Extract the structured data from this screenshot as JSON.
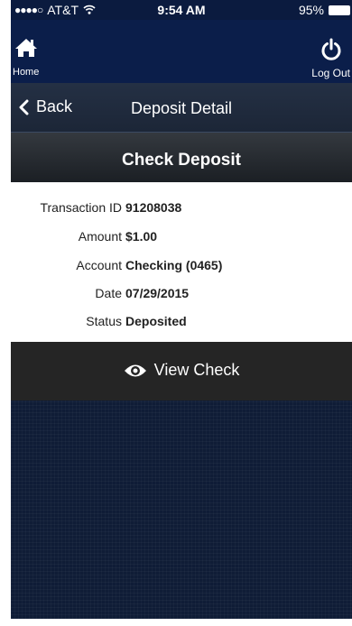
{
  "status_bar": {
    "signal_dots": "●●●●○",
    "carrier": "AT&T",
    "time": "9:54 AM",
    "battery_percent": "95%"
  },
  "header": {
    "home_label": "Home",
    "logout_label": "Log Out"
  },
  "nav": {
    "back_label": "Back",
    "title": "Deposit Detail"
  },
  "section": {
    "title": "Check Deposit"
  },
  "details": [
    {
      "label": "Transaction ID",
      "value": "91208038"
    },
    {
      "label": "Amount",
      "value": "$1.00"
    },
    {
      "label": "Account",
      "value": "Checking (0465)"
    },
    {
      "label": "Date",
      "value": "07/29/2015"
    },
    {
      "label": "Status",
      "value": "Deposited"
    }
  ],
  "actions": {
    "view_check_label": "View Check"
  },
  "icons": {
    "home": "home-icon",
    "logout": "power-icon",
    "back": "chevron-left-icon",
    "view": "eye-icon",
    "wifi": "wifi-icon",
    "battery": "battery-icon"
  },
  "colors": {
    "header_bg": "#0b1e4a",
    "back_bar_bg": "#243044",
    "section_bg": "#2a2e33",
    "view_check_bg": "#252525",
    "background": "#0f1c36"
  }
}
